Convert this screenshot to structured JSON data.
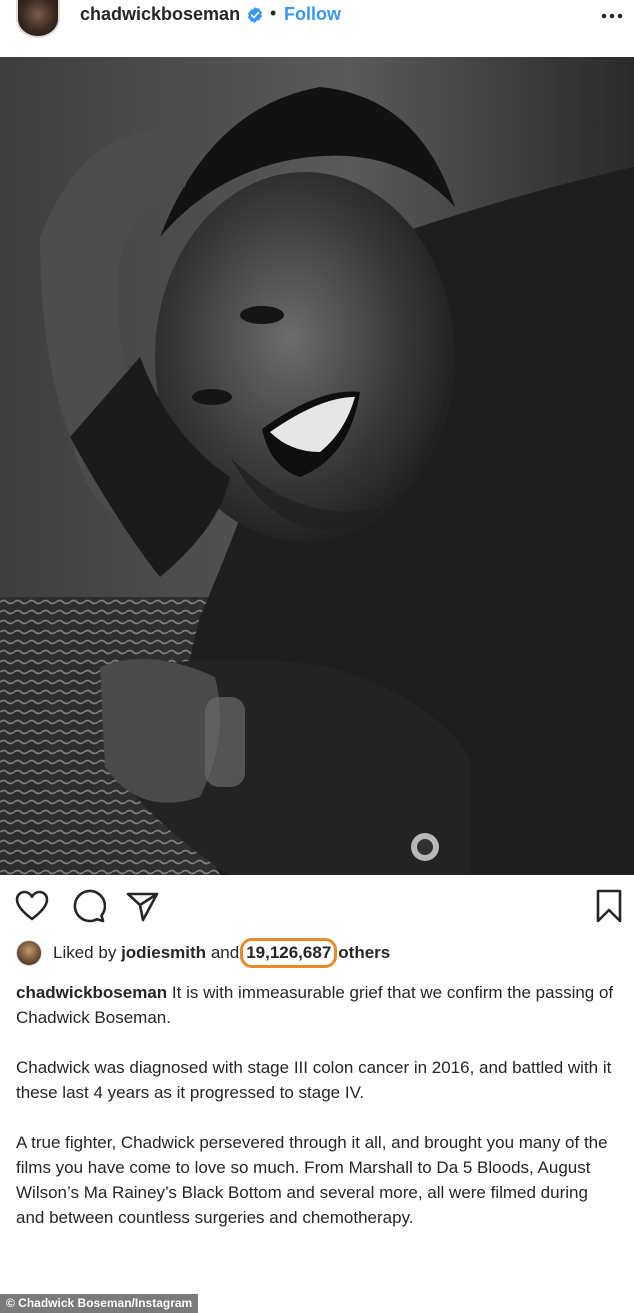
{
  "header": {
    "username": "chadwickboseman",
    "dot": "•",
    "follow_label": "Follow"
  },
  "photo": {
    "alt": "Black and white portrait of Chadwick Boseman smiling, resting his head on his hand"
  },
  "likes": {
    "prefix": "Liked by",
    "liker": "jodiesmith",
    "conj": "and",
    "count": "19,126,687",
    "suffix": "others"
  },
  "caption": {
    "username": "chadwickboseman",
    "p1": "It is with immeasurable grief that we confirm the passing of Chadwick Boseman.",
    "p2": "Chadwick was diagnosed with stage III colon cancer in 2016, and battled with it these last 4 years as it progressed to stage IV.",
    "p3": "A true fighter, Chadwick persevered through it all, and brought you many of the films you have come to love so much. From Marshall to Da 5 Bloods, August Wilson’s Ma Rainey’s Black Bottom and several more, all were filmed during and between countless surgeries and chemotherapy."
  },
  "credit": "© Chadwick Boseman/Instagram",
  "colors": {
    "accent": "#3897f0",
    "highlight": "#e8892a",
    "text": "#262626"
  },
  "icons": [
    "verified-icon",
    "more-options-icon",
    "heart-icon",
    "comment-icon",
    "share-icon",
    "bookmark-icon"
  ]
}
